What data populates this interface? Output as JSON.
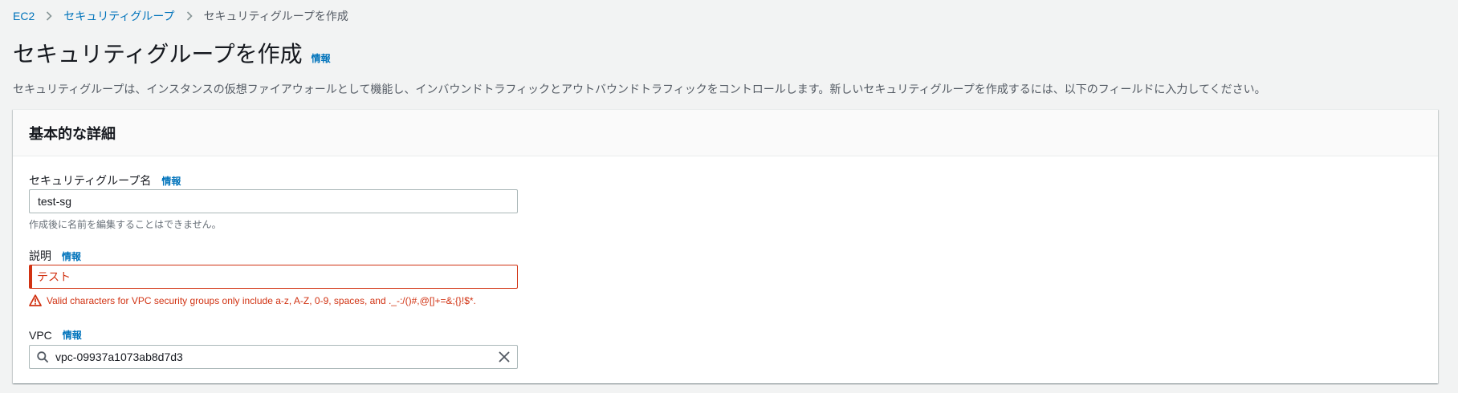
{
  "breadcrumb": {
    "items": [
      "EC2",
      "セキュリティグループ",
      "セキュリティグループを作成"
    ]
  },
  "header": {
    "title": "セキュリティグループを作成",
    "info_label": "情報",
    "description": "セキュリティグループは、インスタンスの仮想ファイアウォールとして機能し、インバウンドトラフィックとアウトバウンドトラフィックをコントロールします。新しいセキュリティグループを作成するには、以下のフィールドに入力してください。"
  },
  "basic_details": {
    "title": "基本的な詳細",
    "name_field": {
      "label": "セキュリティグループ名",
      "info_label": "情報",
      "value": "test-sg",
      "constraint": "作成後に名前を編集することはできません。"
    },
    "description_field": {
      "label": "説明",
      "info_label": "情報",
      "value": "テスト",
      "error": "Valid characters for VPC security groups only include a-z, A-Z, 0-9, spaces, and ._-:/()#,@[]+=&;{}!$*."
    },
    "vpc_field": {
      "label": "VPC",
      "info_label": "情報",
      "value": "vpc-09937a1073ab8d7d3"
    }
  },
  "icons": {
    "breadcrumb_separator": "chevron-right-icon",
    "error": "warning-icon",
    "search": "search-icon",
    "clear": "close-icon"
  },
  "colors": {
    "link": "#0073bb",
    "error": "#d13212",
    "background": "#f2f3f3",
    "text": "#16191f",
    "secondary_text": "#545b64"
  }
}
